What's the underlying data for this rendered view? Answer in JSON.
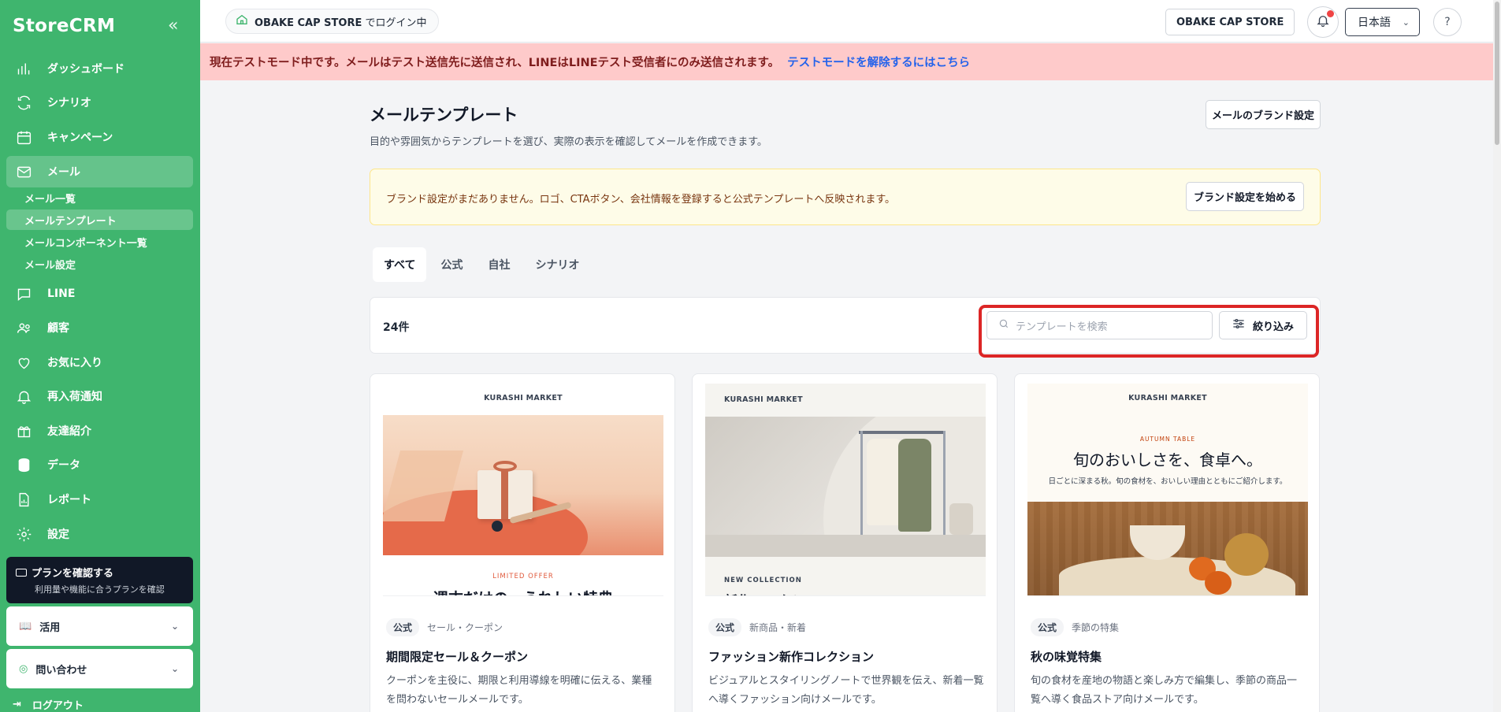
{
  "app": {
    "name": "StoreCRM",
    "collapse_icon": "double-chevron-left-icon"
  },
  "sidebar": {
    "items": [
      {
        "label": "ダッシュボード",
        "icon": "bar-chart-icon"
      },
      {
        "label": "シナリオ",
        "icon": "refresh-icon"
      },
      {
        "label": "キャンペーン",
        "icon": "calendar-icon"
      },
      {
        "label": "メール",
        "icon": "mail-icon"
      },
      {
        "label": "LINE",
        "icon": "chat-icon"
      },
      {
        "label": "顧客",
        "icon": "users-icon"
      },
      {
        "label": "お気に入り",
        "icon": "heart-icon"
      },
      {
        "label": "再入荷通知",
        "icon": "bell-icon"
      },
      {
        "label": "友達紹介",
        "icon": "gift-icon"
      },
      {
        "label": "データ",
        "icon": "database-icon"
      },
      {
        "label": "レポート",
        "icon": "report-icon"
      },
      {
        "label": "設定",
        "icon": "gear-icon"
      }
    ],
    "mail_sub": [
      "メール一覧",
      "メールテンプレート",
      "メールコンポーネント一覧",
      "メール設定"
    ],
    "plan": {
      "title": "プランを確認する",
      "subtitle": "利用量や機能に合うプランを確認"
    },
    "usage": "活用",
    "contact": "問い合わせ",
    "logout": "ログアウト"
  },
  "topbar": {
    "store_name": "OBAKE CAP STORE",
    "login_suffix": "でログイン中",
    "store_select": "OBAKE CAP STORE",
    "language": "日本語"
  },
  "banner": {
    "text": "現在テストモード中です。メールはテスト送信先に送信され、LINEはLINEテスト受信者にのみ送信されます。",
    "link": "テストモードを解除するにはこちら"
  },
  "main": {
    "title": "メールテンプレート",
    "description": "目的や雰囲気からテンプレートを選び、実際の表示を確認してメールを作成できます。",
    "brand_button": "メールのブランド設定",
    "notice": "ブランド設定がまだありません。ロゴ、CTAボタン、会社情報を登録すると公式テンプレートへ反映されます。",
    "notice_button": "ブランド設定を始める",
    "tabs": [
      "すべて",
      "公式",
      "自社",
      "シナリオ"
    ],
    "count": "24件",
    "search_placeholder": "テンプレートを検索",
    "filter_label": "絞り込み"
  },
  "cards": [
    {
      "brand": "KURASHI MARKET",
      "eyebrow": "LIMITED OFFER",
      "headline_partial": "週末だけの、うれしい特典",
      "tag": "公式",
      "category": "セール・クーポン",
      "title": "期間限定セール＆クーポン",
      "description": "クーポンを主役に、期限と利用導線を明確に伝える、業種を問わないセールメールです。"
    },
    {
      "brand": "KURASHI MARKET",
      "eyebrow": "NEW COLLECTION",
      "headline_partial": "新作コレクション",
      "tag": "公式",
      "category": "新商品・新着",
      "title": "ファッション新作コレクション",
      "description": "ビジュアルとスタイリングノートで世界観を伝え、新着一覧へ導くファッション向けメールです。"
    },
    {
      "brand": "KURASHI MARKET",
      "eyebrow": "AUTUMN TABLE",
      "headline": "旬のおいしさを、食卓へ。",
      "subline": "日ごとに深まる秋。旬の食材を、おいしい理由とともにご紹介します。",
      "tag": "公式",
      "category": "季節の特集",
      "title": "秋の味覚特集",
      "description": "旬の食材を産地の物語と楽しみ方で編集し、季節の商品一覧へ導く食品ストア向けメールです。"
    }
  ],
  "colors": {
    "sidebar": "#3fb56e",
    "banner_bg": "#fecaca",
    "link": "#2563eb",
    "highlight": "#dc2626"
  }
}
